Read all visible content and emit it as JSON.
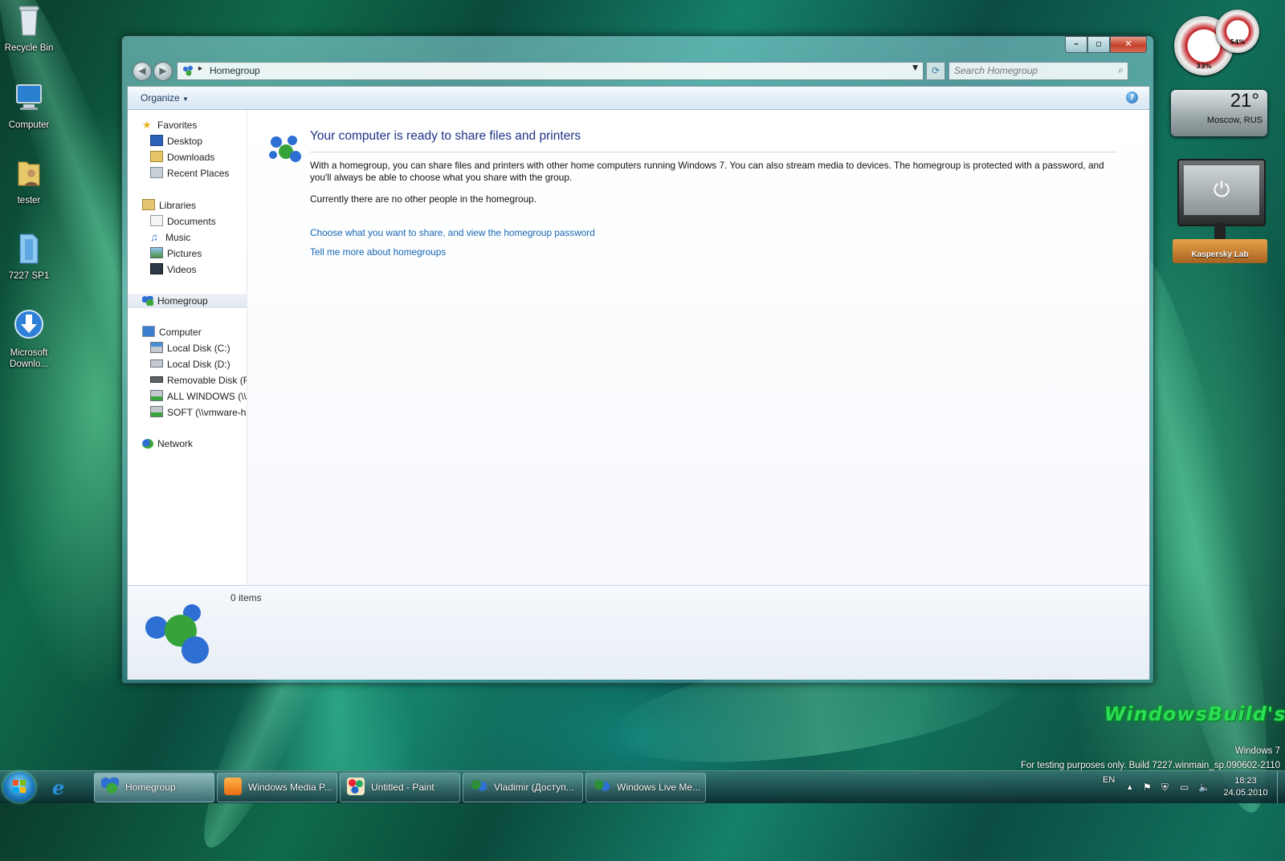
{
  "desktop": {
    "icons": [
      {
        "label": "Recycle Bin"
      },
      {
        "label": "Computer"
      },
      {
        "label": "tester"
      },
      {
        "label": "7227 SP1"
      },
      {
        "label": "Microsoft Downlo..."
      }
    ],
    "watermark": {
      "brand": "WindowsBuild's",
      "line1": "Windows 7",
      "line2": "For testing purposes only. Build 7227.winmain_sp.090602-2110"
    }
  },
  "gadgets": {
    "cpu_percent": "33%",
    "mem_percent": "54%",
    "weather_temp": "21°",
    "weather_city": "Moscow, RUS",
    "kaspersky_label": "Kaspersky Lab"
  },
  "window": {
    "caption_buttons": {
      "minimize": "–",
      "maximize": "▫",
      "close": "✕"
    },
    "address": {
      "crumb": "Homegroup"
    },
    "search": {
      "placeholder": "Search Homegroup"
    },
    "toolbar": {
      "organize": "Organize"
    },
    "nav": {
      "favorites": "Favorites",
      "desktop": "Desktop",
      "downloads": "Downloads",
      "recent": "Recent Places",
      "libraries": "Libraries",
      "documents": "Documents",
      "music": "Music",
      "pictures": "Pictures",
      "videos": "Videos",
      "homegroup": "Homegroup",
      "computer": "Computer",
      "disk_c": "Local Disk (C:)",
      "disk_d": "Local Disk (D:)",
      "disk_f": "Removable Disk (F:)",
      "share1": "ALL WINDOWS (\\\\vmware-host)",
      "share2": "SOFT (\\\\vmware-host)",
      "network": "Network"
    },
    "content": {
      "title": "Your computer is ready to share files and printers",
      "para1": "With a homegroup, you can share files and printers with other home computers running Windows 7. You can also stream media to devices. The homegroup is protected with a password, and you'll always be able to choose what you share with the group.",
      "para2": "Currently there are no other people in the homegroup.",
      "link1": "Choose what you want to share, and view the homegroup password",
      "link2": "Tell me more about homegroups"
    },
    "details": {
      "count": "0 items"
    }
  },
  "taskbar": {
    "buttons": [
      {
        "label": "Homegroup"
      },
      {
        "label": "Windows Media P..."
      },
      {
        "label": "Untitled - Paint"
      },
      {
        "label": "Vladimir (Доступ..."
      },
      {
        "label": "Windows Live Me..."
      }
    ],
    "lang": "EN",
    "time": "18:23",
    "date": "24.05.2010"
  },
  "colors": {
    "accent": "#1e3287",
    "link": "#1565b3",
    "close": "#c4412b"
  }
}
